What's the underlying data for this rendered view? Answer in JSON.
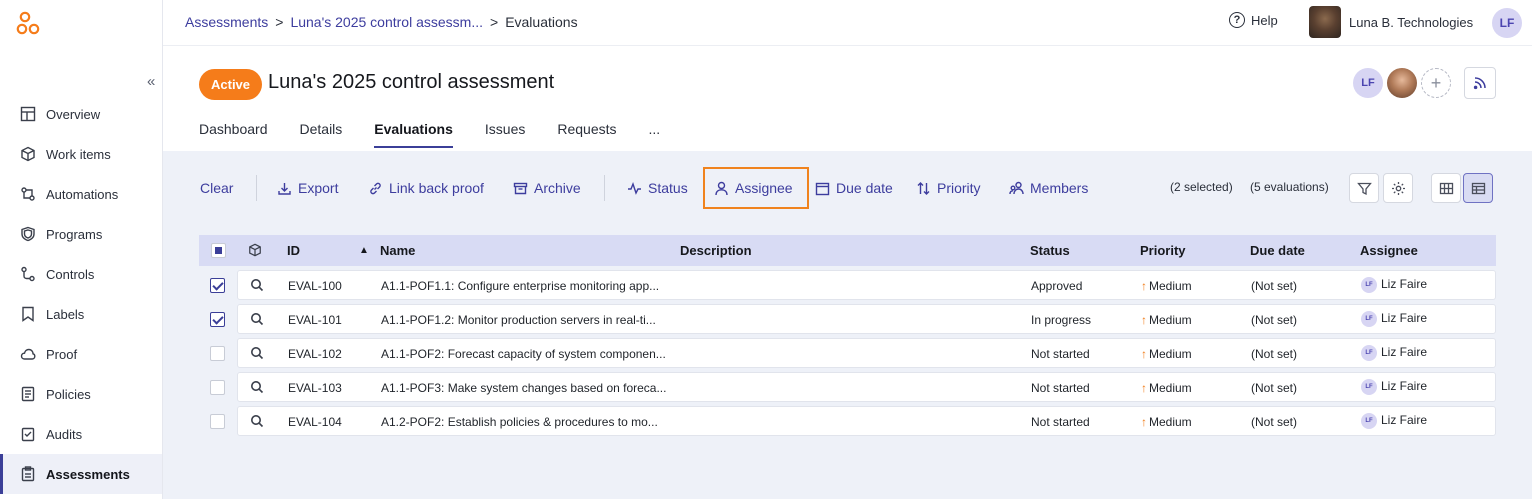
{
  "app": {
    "brand_color": "#f57c1a",
    "accent": "#3b3f98"
  },
  "sidebar": {
    "items": [
      {
        "label": "Overview",
        "icon": "dashboard-icon"
      },
      {
        "label": "Work items",
        "icon": "box-icon"
      },
      {
        "label": "Automations",
        "icon": "automation-icon"
      },
      {
        "label": "Programs",
        "icon": "shield-icon"
      },
      {
        "label": "Controls",
        "icon": "controls-icon"
      },
      {
        "label": "Labels",
        "icon": "label-icon"
      },
      {
        "label": "Proof",
        "icon": "cloud-icon"
      },
      {
        "label": "Policies",
        "icon": "policy-icon"
      },
      {
        "label": "Audits",
        "icon": "audit-icon"
      },
      {
        "label": "Assessments",
        "icon": "clipboard-icon",
        "active": true
      }
    ]
  },
  "topbar": {
    "breadcrumb": [
      "Assessments",
      "Luna's 2025 control assessm...",
      "Evaluations"
    ],
    "help": "Help",
    "org_name": "Luna B. Technologies",
    "user_initials": "LF"
  },
  "header": {
    "status_badge": "Active",
    "title": "Luna's 2025 control assessment",
    "member_initials": "LF",
    "add_member": "+",
    "tabs": [
      "Dashboard",
      "Details",
      "Evaluations",
      "Issues",
      "Requests",
      "..."
    ],
    "active_tab": "Evaluations"
  },
  "toolbar": {
    "clear": "Clear",
    "export": "Export",
    "link_back_proof": "Link back proof",
    "archive": "Archive",
    "status": "Status",
    "assignee": "Assignee",
    "due_date": "Due date",
    "priority": "Priority",
    "members": "Members",
    "selected_count": "(2 selected)",
    "evaluations_count": "(5 evaluations)"
  },
  "table": {
    "columns": {
      "id": "ID",
      "name": "Name",
      "description": "Description",
      "status": "Status",
      "priority": "Priority",
      "due_date": "Due date",
      "assignee": "Assignee"
    },
    "rows": [
      {
        "checked": true,
        "id": "EVAL-100",
        "name": "A1.1-POF1.1: Configure enterprise monitoring app...",
        "description": "",
        "status": "Approved",
        "priority": "Medium",
        "due_date": "(Not set)",
        "assignee_initials": "LF",
        "assignee": "Liz Faire"
      },
      {
        "checked": true,
        "id": "EVAL-101",
        "name": "A1.1-POF1.2: Monitor production servers in real-ti...",
        "description": "",
        "status": "In progress",
        "priority": "Medium",
        "due_date": "(Not set)",
        "assignee_initials": "LF",
        "assignee": "Liz Faire"
      },
      {
        "checked": false,
        "id": "EVAL-102",
        "name": "A1.1-POF2: Forecast capacity of system componen...",
        "description": "",
        "status": "Not started",
        "priority": "Medium",
        "due_date": "(Not set)",
        "assignee_initials": "LF",
        "assignee": "Liz Faire"
      },
      {
        "checked": false,
        "id": "EVAL-103",
        "name": "A1.1-POF3: Make system changes based on foreca...",
        "description": "",
        "status": "Not started",
        "priority": "Medium",
        "due_date": "(Not set)",
        "assignee_initials": "LF",
        "assignee": "Liz Faire"
      },
      {
        "checked": false,
        "id": "EVAL-104",
        "name": "A1.2-POF2: Establish policies & procedures to mo...",
        "description": "",
        "status": "Not started",
        "priority": "Medium",
        "due_date": "(Not set)",
        "assignee_initials": "LF",
        "assignee": "Liz Faire"
      }
    ]
  }
}
